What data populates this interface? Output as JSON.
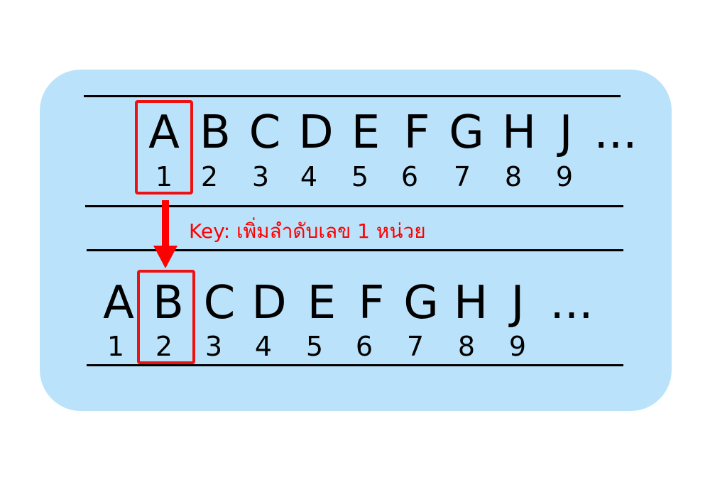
{
  "row_before": {
    "letters": [
      "A",
      "B",
      "C",
      "D",
      "E",
      "F",
      "G",
      "H",
      "J",
      "..."
    ],
    "numbers": [
      "1",
      "2",
      "3",
      "4",
      "5",
      "6",
      "7",
      "8",
      "9"
    ],
    "highlighted_index": 0
  },
  "row_after": {
    "letters": [
      "A",
      "B",
      "C",
      "D",
      "E",
      "F",
      "G",
      "H",
      "J",
      "..."
    ],
    "numbers": [
      "1",
      "2",
      "3",
      "4",
      "5",
      "6",
      "7",
      "8",
      "9"
    ],
    "highlighted_index": 1
  },
  "key_label": "Key: เพิ่มลำดับเลข 1 หน่วย",
  "colors": {
    "panel": "#bae3fb",
    "highlight": "#ee1111",
    "key_text": "#ff0000",
    "rules": "#000000"
  }
}
